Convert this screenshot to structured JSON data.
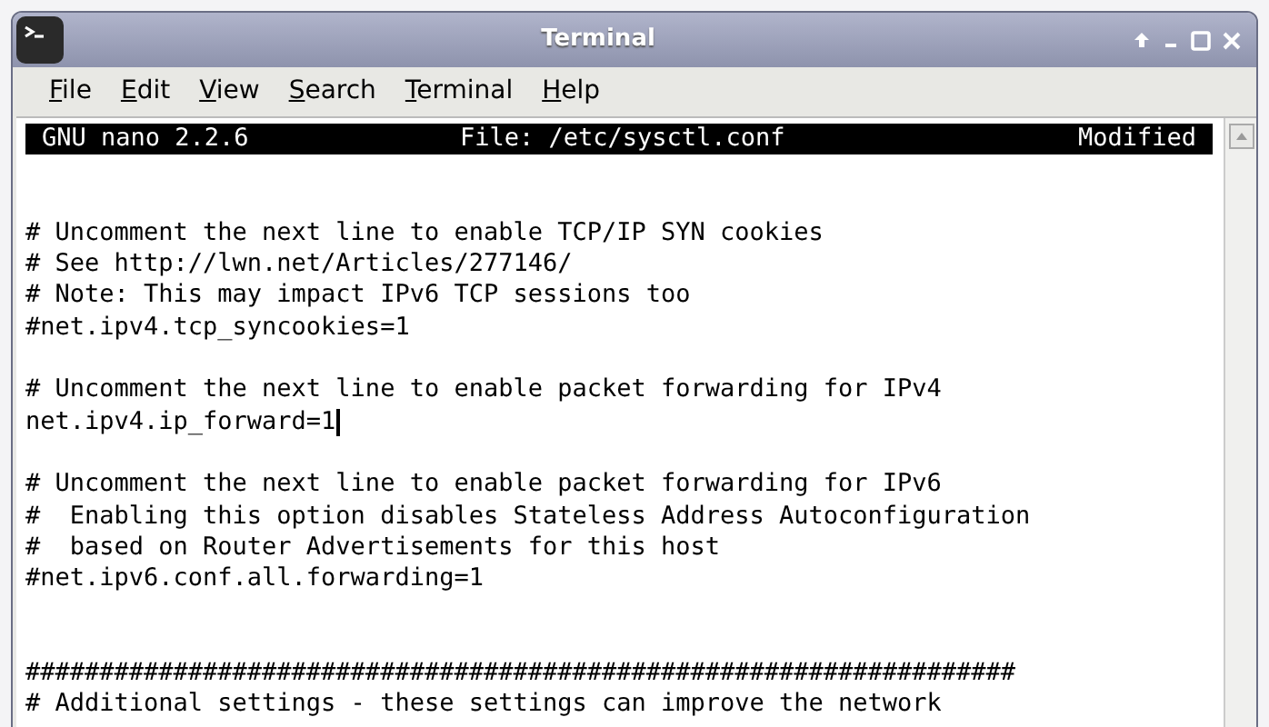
{
  "window": {
    "title": "Terminal"
  },
  "menu": [
    {
      "label": "File"
    },
    {
      "label": "Edit"
    },
    {
      "label": "View"
    },
    {
      "label": "Search"
    },
    {
      "label": "Terminal"
    },
    {
      "label": "Help"
    }
  ],
  "nano_header": {
    "version": "GNU nano 2.2.6",
    "file": "File: /etc/sysctl.conf",
    "status": "Modified"
  },
  "lines": [
    {
      "kind": "blank"
    },
    {
      "kind": "blank"
    },
    {
      "kind": "code",
      "text": "# Uncomment the next line to enable TCP/IP SYN cookies"
    },
    {
      "kind": "code",
      "text": "# See http://lwn.net/Articles/277146/"
    },
    {
      "kind": "code",
      "text": "# Note: This may impact IPv6 TCP sessions too"
    },
    {
      "kind": "code",
      "text": "#net.ipv4.tcp_syncookies=1"
    },
    {
      "kind": "blank"
    },
    {
      "kind": "code",
      "text": "# Uncomment the next line to enable packet forwarding for IPv4"
    },
    {
      "kind": "code",
      "text": "net.ipv4.ip_forward=1",
      "cursor": true
    },
    {
      "kind": "blank"
    },
    {
      "kind": "code",
      "text": "# Uncomment the next line to enable packet forwarding for IPv6"
    },
    {
      "kind": "code",
      "text": "#  Enabling this option disables Stateless Address Autoconfiguration"
    },
    {
      "kind": "code",
      "text": "#  based on Router Advertisements for this host"
    },
    {
      "kind": "code",
      "text": "#net.ipv6.conf.all.forwarding=1"
    },
    {
      "kind": "blank"
    },
    {
      "kind": "blank"
    },
    {
      "kind": "code",
      "text": "###################################################################"
    },
    {
      "kind": "code",
      "text": "# Additional settings - these settings can improve the network"
    }
  ]
}
